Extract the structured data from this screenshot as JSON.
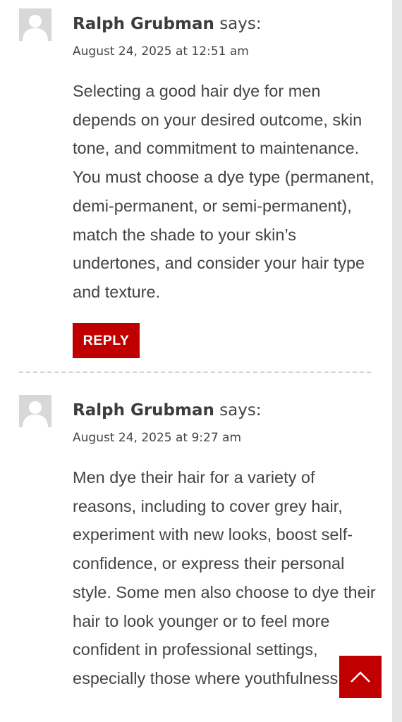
{
  "comments": [
    {
      "author": "Ralph Grubman",
      "says": "says:",
      "date": "August 24, 2025 at 12:51 am",
      "text": "Selecting a good hair dye for men depends on your desired outcome, skin tone, and commitment to maintenance. You must choose a dye type (permanent, demi-permanent, or semi-permanent), match the shade to your skin’s undertones, and consider your hair type and texture.",
      "reply_label": "REPLY"
    },
    {
      "author": "Ralph Grubman",
      "says": "says:",
      "date": "August 24, 2025 at 9:27 am",
      "text": "Men dye their hair for a variety of reasons, including to cover grey hair, experiment with new looks, boost self-confidence, or express their personal style. Some men also choose to dye their hair to look younger or to feel more confident in professional settings, especially those where youthfulness is"
    }
  ],
  "icons": {
    "avatar": "default-avatar-icon",
    "back_to_top": "chevron-up-icon"
  },
  "colors": {
    "accent": "#c00000",
    "text": "#444444",
    "avatar_bg": "#d8d8d8"
  }
}
